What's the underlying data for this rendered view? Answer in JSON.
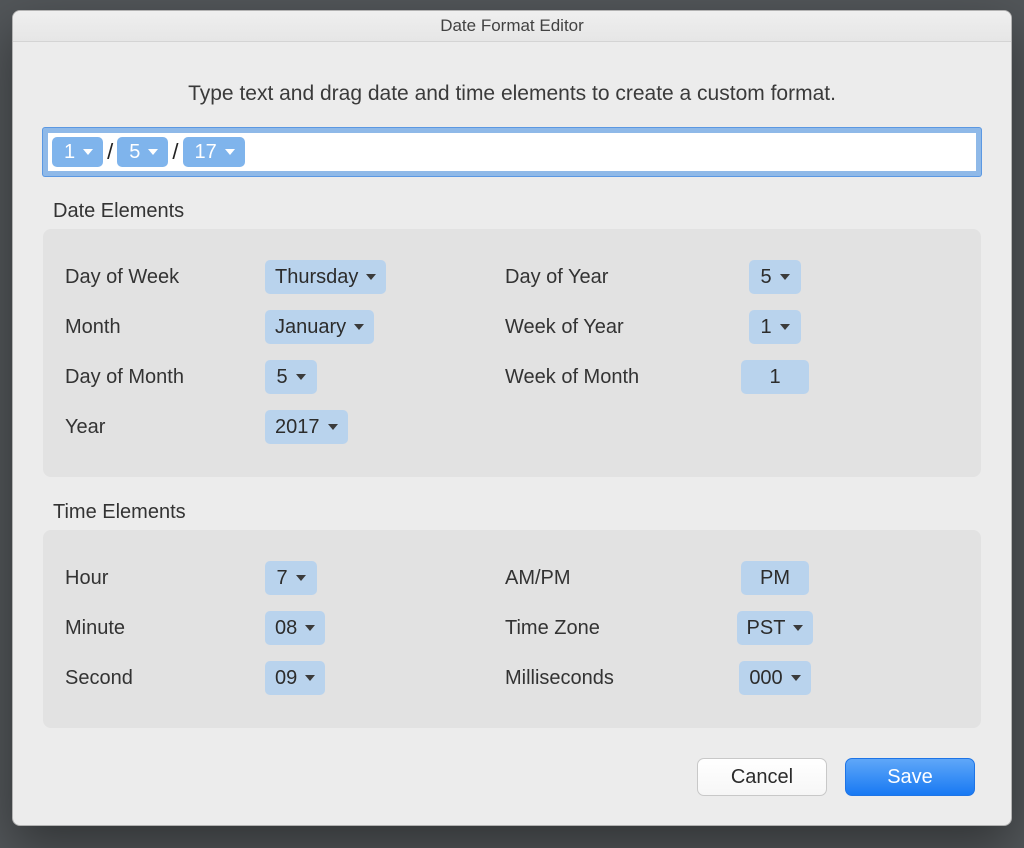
{
  "title": "Date Format Editor",
  "instructions": "Type text and drag date and time elements to create a custom format.",
  "format_bar": {
    "tokens": [
      "1",
      "5",
      "17"
    ],
    "separator": "/"
  },
  "sections": {
    "date": {
      "title": "Date Elements",
      "items": {
        "day_of_week": {
          "label": "Day of Week",
          "value": "Thursday",
          "arrow": true
        },
        "day_of_year": {
          "label": "Day of Year",
          "value": "5",
          "arrow": true
        },
        "month": {
          "label": "Month",
          "value": "January",
          "arrow": true
        },
        "week_of_year": {
          "label": "Week of Year",
          "value": "1",
          "arrow": true
        },
        "day_of_month": {
          "label": "Day of Month",
          "value": "5",
          "arrow": true
        },
        "week_of_month": {
          "label": "Week of Month",
          "value": "1",
          "arrow": false
        },
        "year": {
          "label": "Year",
          "value": "2017",
          "arrow": true
        }
      }
    },
    "time": {
      "title": "Time Elements",
      "items": {
        "hour": {
          "label": "Hour",
          "value": "7",
          "arrow": true
        },
        "ampm": {
          "label": "AM/PM",
          "value": "PM",
          "arrow": false
        },
        "minute": {
          "label": "Minute",
          "value": "08",
          "arrow": true
        },
        "time_zone": {
          "label": "Time Zone",
          "value": "PST",
          "arrow": true
        },
        "second": {
          "label": "Second",
          "value": "09",
          "arrow": true
        },
        "milliseconds": {
          "label": "Milliseconds",
          "value": "000",
          "arrow": true
        }
      }
    }
  },
  "buttons": {
    "cancel": "Cancel",
    "save": "Save"
  }
}
